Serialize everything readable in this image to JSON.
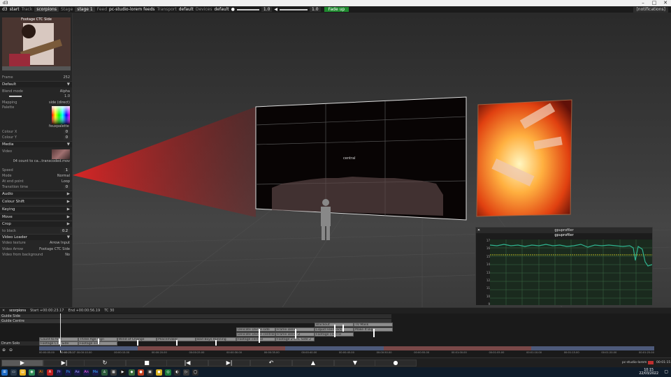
{
  "window": {
    "title": "d3"
  },
  "toolbar": {
    "app": "d3",
    "start": "start",
    "track_label": "Track",
    "track_value": "scorpions",
    "stage_label": "Stage",
    "stage_value": "stage 1",
    "feed_label": "Feed",
    "feed_value": "pc-studio-lorem feeds",
    "transport_label": "Transport",
    "transport_value": "default",
    "devices_label": "Devices",
    "devices_value": "default",
    "brightness_value": "1.0",
    "volume_value": "1.0",
    "fade_up_label": "Fade up",
    "notifications_label": "[notifications]"
  },
  "left_panel": {
    "thumbnail_title": "Footage CTC Side",
    "frame_label": "Frame",
    "frame_value": "252",
    "default_section": "Default",
    "blend_mode_label": "Blend mode",
    "blend_mode_value": "Alpha",
    "brightness_value": "1.0",
    "mapping_label": "Mapping",
    "mapping_value": "side (direct)",
    "palette_label": "Palette",
    "palette_name": "feuxpalette",
    "colour_x_label": "Colour X",
    "colour_x_value": "0",
    "colour_y_label": "Colour Y",
    "colour_y_value": "0",
    "media_section": "Media",
    "video_label": "Video",
    "video_file": "04 count to ca...transcoded.mov",
    "speed_label": "Speed",
    "speed_value": "1",
    "mode_label": "Mode",
    "mode_value": "Normal",
    "at_end_label": "At end point",
    "at_end_value": "Loop",
    "transition_label": "Transition time",
    "transition_value": "0",
    "audio_section": "Audio",
    "colour_shift_section": "Colour Shift",
    "keying_section": "Keying",
    "move_section": "Move",
    "crop_section": "Crop",
    "to_black_label": "to black",
    "to_black_value": "0.2",
    "video_loader_section": "Video Loader",
    "video_texture_label": "Video texture",
    "video_texture_value": "Arrow Input",
    "video_arrow_label": "Video Arrow",
    "video_arrow_value": "Footage CTC Side",
    "video_background_label": "Video from background",
    "video_background_value": "No"
  },
  "viewport": {
    "screen_label": "central"
  },
  "gpu_profiler": {
    "title": "gpuprofiler",
    "subtitle": "gpuprofiler",
    "y_max_label": "17",
    "y_ticks": [
      "16",
      "15",
      "14",
      "13",
      "12",
      "11",
      "10",
      "9"
    ],
    "series_color": "#2fb38f",
    "threshold_color": "#e4e02a"
  },
  "timeline": {
    "track_name": "scorpions",
    "start": "Start +00:00:23.17",
    "end": "End +00:00:56.19",
    "tc": "TC 30",
    "lanes": [
      "Guide Side",
      "Guide Centre",
      "Drum Solo"
    ],
    "clips": [
      "Delicate Dance side",
      "Frame Delay",
      "Blackout",
      "TV Mask",
      "Delicate Dance central",
      "Frame Delay 2",
      "Liquid Feedback",
      "Make It Big",
      "Footage central",
      "Footage 2 CTC Side 2",
      "Footage central",
      "Count to four",
      "Three Age Sign",
      "Wind of Change",
      "Peacemaker",
      "Bad Boys Running",
      "Footage CTC Side",
      "Footage side"
    ],
    "ruler_times": [
      "00:00:05.00",
      "00:00:10.00",
      "00:00:15.00",
      "00:00:20.00",
      "00:00:25.00",
      "00:00:30.00",
      "00:00:35.00",
      "00:00:40.00",
      "00:00:45.00",
      "00:00:50.00",
      "00:00:55.00",
      "00:01:00.00",
      "00:01:05.00",
      "00:01:10.00",
      "00:01:15.00",
      "00:01:20.00",
      "00:01:25.00"
    ],
    "ruler_edge_time": "00:00:23.17"
  },
  "statusbar": {
    "machine": "pc-studio-lorem",
    "time": "00:01:15"
  },
  "taskbar": {
    "clock_time": "10:15",
    "clock_date": "22/03/2022"
  }
}
